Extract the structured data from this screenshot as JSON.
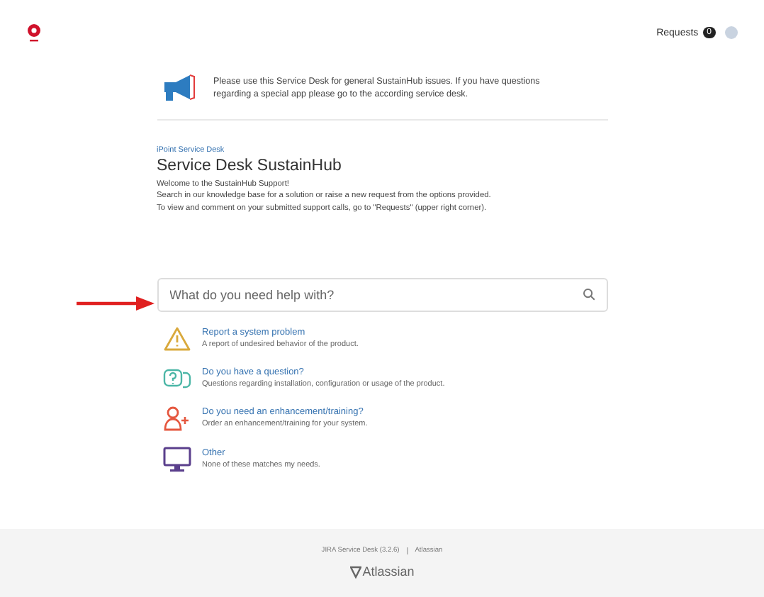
{
  "header": {
    "requests_label": "Requests",
    "requests_count": "0"
  },
  "notice": {
    "text": "Please use this Service Desk for general SustainHub issues. If you have questions regarding a special app please go to the according service desk."
  },
  "portal": {
    "breadcrumb": "iPoint Service Desk",
    "title": "Service Desk SustainHub",
    "description": [
      "Welcome to the SustainHub Support!",
      "Search in our knowledge base for a solution or raise a new request from the options provided.",
      "To view and comment on your submitted support calls, go to \"Requests\" (upper right corner)."
    ]
  },
  "search": {
    "placeholder": "What do you need help with?"
  },
  "request_types": [
    {
      "kind": "warning",
      "title": "Report a system problem",
      "description": "A report of undesired behavior of the product."
    },
    {
      "kind": "question",
      "title": "Do you have a question?",
      "description": "Questions regarding installation, configuration or usage of the product."
    },
    {
      "kind": "person",
      "title": "Do you need an enhancement/training?",
      "description": "Order an enhancement/training for your system."
    },
    {
      "kind": "monitor",
      "title": "Other",
      "description": "None of these matches my needs."
    }
  ],
  "footer": {
    "text": "JIRA Service Desk (3.2.6)",
    "link": "Atlassian",
    "logo": "Atlassian"
  }
}
